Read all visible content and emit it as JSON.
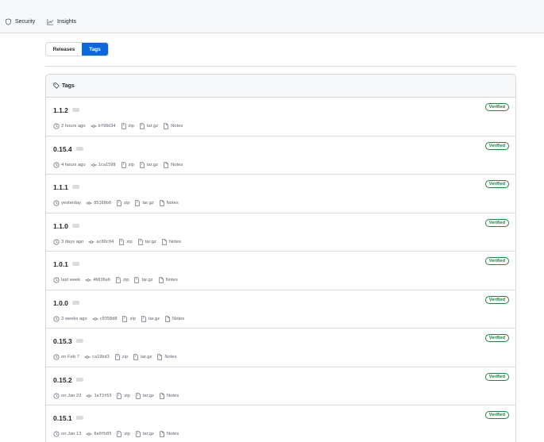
{
  "nav": {
    "security": "Security",
    "insights": "Insights"
  },
  "segmented": {
    "releases": "Releases",
    "tags": "Tags"
  },
  "box": {
    "title": "Tags"
  },
  "labels": {
    "zip": "zip",
    "targz": "tar.gz",
    "notes": "Notes",
    "verified": "Verified"
  },
  "tags": [
    {
      "name": "1.1.2",
      "time": "2 hours ago",
      "sha": "bf98d34"
    },
    {
      "name": "0.15.4",
      "time": "4 hours ago",
      "sha": "1ca1598"
    },
    {
      "name": "1.1.1",
      "time": "yesterday",
      "sha": "85160b0"
    },
    {
      "name": "1.1.0",
      "time": "3 days ago",
      "sha": "ac80c04"
    },
    {
      "name": "1.0.1",
      "time": "last week",
      "sha": "46036e6"
    },
    {
      "name": "1.0.0",
      "time": "3 weeks ago",
      "sha": "c0358d8"
    },
    {
      "name": "0.15.3",
      "time": "on Feb 7",
      "sha": "ca19bd3"
    },
    {
      "name": "0.15.2",
      "time": "on Jan 22",
      "sha": "1e73f63"
    },
    {
      "name": "0.15.1",
      "time": "on Jan 13",
      "sha": "6e0fb05"
    }
  ],
  "colors": {
    "accent": "#0969da",
    "verified": "#1a7f37",
    "muted": "#59636e",
    "border": "#d0d7de"
  },
  "icons": {
    "security": "shield-icon",
    "insights": "graph-icon",
    "tag": "tag-icon",
    "clock": "clock-icon",
    "commit": "git-commit-icon",
    "zip": "file-zip-icon",
    "notes": "file-icon"
  }
}
